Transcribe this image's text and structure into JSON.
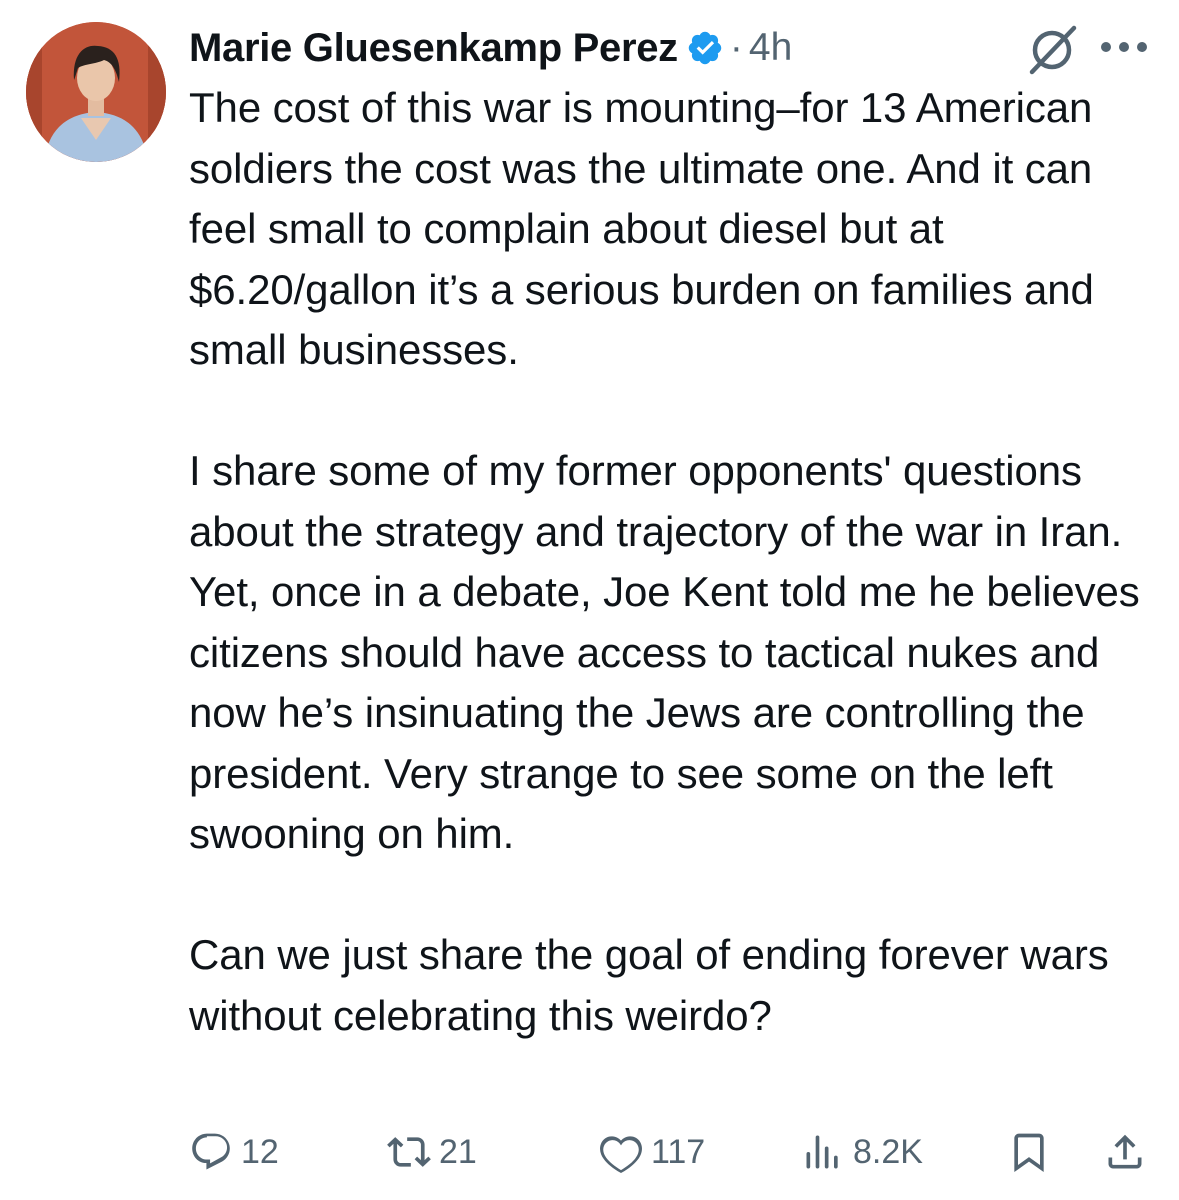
{
  "tweet": {
    "author": {
      "display_name": "Marie Gluesenkamp Perez",
      "verified": true
    },
    "meta_separator": "·",
    "time": "4h",
    "paragraphs": [
      "The cost of this war is mounting–for 13 American soldiers the cost was the ultimate one. And it can feel small to complain about diesel but at $6.20/gallon it’s a serious burden on families and small businesses.",
      "I share some of my former opponents' questions about the strategy and trajectory of the war in Iran. Yet, once in a debate, Joe Kent told me he believes citizens should have access to tactical nukes and now he’s insinuating the Jews are controlling the president. Very strange to see some on the left swooning on him.",
      "Can we just share the goal of ending forever wars without celebrating this weirdo?"
    ]
  },
  "actions": {
    "replies": "12",
    "reposts": "21",
    "likes": "117",
    "views": "8.2K"
  },
  "icons": {
    "avatar": "profile-photo",
    "verified": "verified-badge-icon",
    "grok": "grok-icon",
    "more": "more-icon",
    "reply": "reply-icon",
    "repost": "repost-icon",
    "like": "heart-icon",
    "views": "views-icon",
    "bookmark": "bookmark-icon",
    "share": "share-icon"
  },
  "colors": {
    "text": "#0f1419",
    "secondary": "#536471",
    "verified": "#1d9bf0",
    "avatar_background": "#c2553a"
  }
}
